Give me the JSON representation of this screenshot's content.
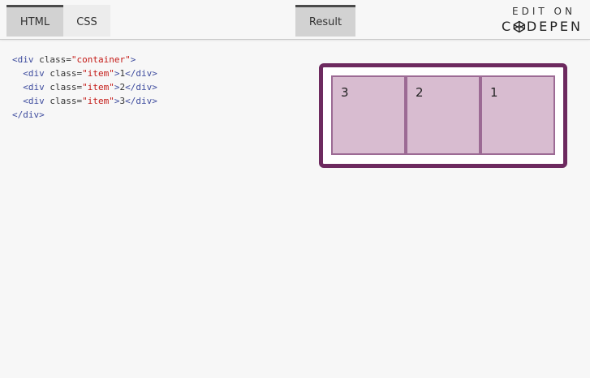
{
  "tabs": {
    "html_label": "HTML",
    "css_label": "CSS",
    "result_label": "Result"
  },
  "edit_on": {
    "label": "EDIT ON",
    "brand_prefix": "C",
    "brand_suffix": "DEPEN"
  },
  "code": {
    "line1": {
      "open": "<div ",
      "attr": "class=",
      "val": "\"container\"",
      "close": ">"
    },
    "line2": {
      "open": "  <div ",
      "attr": "class=",
      "val": "\"item\"",
      "close": ">",
      "text": "1",
      "end": "</div>"
    },
    "line3": {
      "open": "  <div ",
      "attr": "class=",
      "val": "\"item\"",
      "close": ">",
      "text": "2",
      "end": "</div>"
    },
    "line4": {
      "open": "  <div ",
      "attr": "class=",
      "val": "\"item\"",
      "close": ">",
      "text": "3",
      "end": "</div>"
    },
    "line5": {
      "end": "</div>"
    }
  },
  "result": {
    "items": [
      "3",
      "2",
      "1"
    ]
  },
  "colors": {
    "container_border": "#6d2a5f",
    "item_background": "#d8bcd0",
    "item_border": "#9c6a94"
  }
}
